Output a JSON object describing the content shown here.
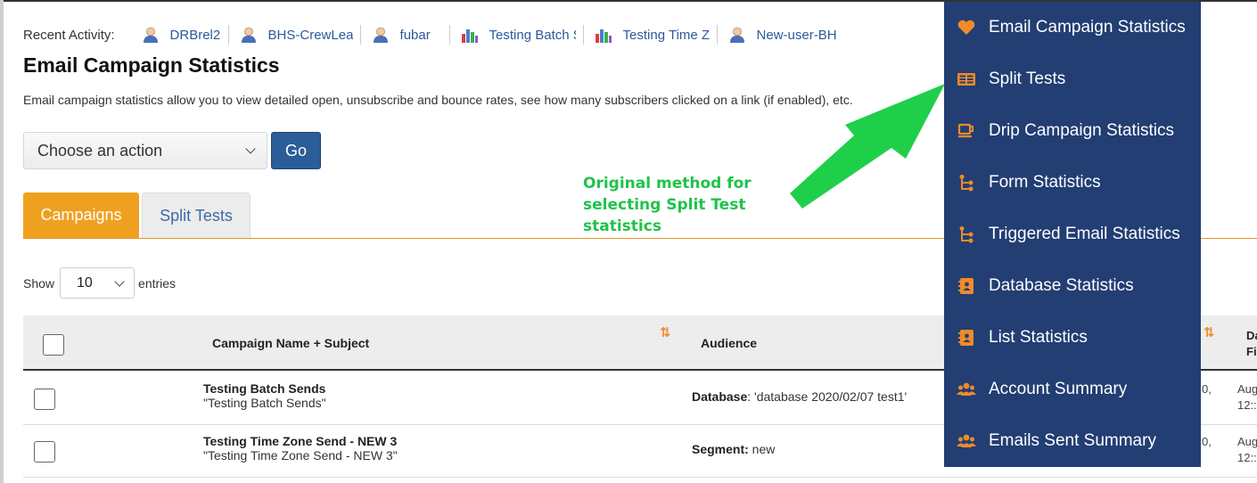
{
  "recent_activity": {
    "label": "Recent Activity:",
    "items": [
      {
        "text": "DRBrel2",
        "icon": "user-icon"
      },
      {
        "text": "BHS-CrewLeac",
        "icon": "user-icon"
      },
      {
        "text": "fubar",
        "icon": "user-icon"
      },
      {
        "text": "Testing Batch S",
        "icon": "bar-chart-icon"
      },
      {
        "text": "Testing Time Z",
        "icon": "bar-chart-icon"
      },
      {
        "text": "New-user-BHS",
        "icon": "user-icon"
      }
    ]
  },
  "page": {
    "title": "Email Campaign Statistics",
    "description": "Email campaign statistics allow you to view detailed open, unsubscribe and bounce rates, see how many subscribers clicked on a link (if enabled), etc."
  },
  "actions": {
    "select_value": "Choose an action",
    "go_label": "Go"
  },
  "tabs": [
    {
      "label": "Campaigns",
      "active": true
    },
    {
      "label": "Split Tests",
      "active": false
    }
  ],
  "annotation": {
    "lines": [
      "Original method for",
      "selecting Split Test",
      "statistics"
    ],
    "color": "#1fc34a"
  },
  "entries": {
    "show_label": "Show",
    "value": "10",
    "suffix_label": "entries"
  },
  "table": {
    "headers": {
      "name": "Campaign Name + Subject",
      "audience": "Audience",
      "right_partial": [
        "Da",
        "Fi"
      ]
    },
    "rows": [
      {
        "name": "Testing Batch Sends",
        "subject": "\"Testing Batch Sends\"",
        "aud_label": "Database",
        "aud_value": ": 'database 2020/02/07 test1'",
        "tail_a": "0,",
        "tail_b": [
          "Aug",
          "12::"
        ]
      },
      {
        "name": "Testing Time Zone Send - NEW 3",
        "subject": "\"Testing Time Zone Send - NEW 3\"",
        "aud_label": "Segment:",
        "aud_value": " new",
        "tail_a": "0,",
        "tail_b": [
          "Aug",
          "12::"
        ]
      }
    ]
  },
  "menu": {
    "background": "#223e73",
    "icon_color": "#f08a2a",
    "items": [
      {
        "label": "Email Campaign Statistics",
        "icon": "heart-icon"
      },
      {
        "label": "Split Tests",
        "icon": "columns-icon"
      },
      {
        "label": "Drip Campaign Statistics",
        "icon": "coffee-cup-icon"
      },
      {
        "label": "Form Statistics",
        "icon": "flow-icon"
      },
      {
        "label": "Triggered Email Statistics",
        "icon": "flow-icon"
      },
      {
        "label": "Database Statistics",
        "icon": "address-book-icon"
      },
      {
        "label": "List Statistics",
        "icon": "address-book-icon"
      },
      {
        "label": "Account Summary",
        "icon": "users-icon"
      },
      {
        "label": "Emails Sent Summary",
        "icon": "users-icon"
      }
    ]
  },
  "colors": {
    "accent_orange": "#f0a020",
    "primary_blue": "#2b5d96",
    "link_blue": "#2a5a9c"
  }
}
